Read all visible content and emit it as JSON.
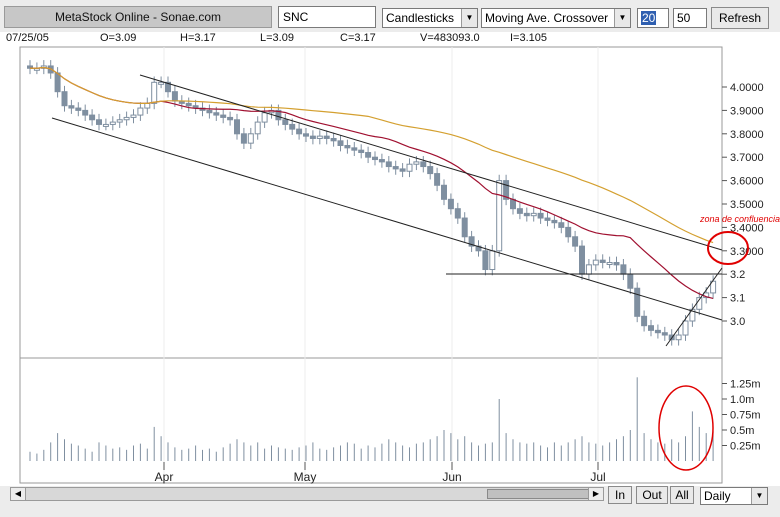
{
  "toolbar": {
    "title": "MetaStock Online - Sonae.com",
    "symbol": "SNC",
    "chart_type": "Candlesticks",
    "indicator": "Moving Ave. Crossover",
    "period1": "20",
    "period2": "50",
    "refresh_label": "Refresh"
  },
  "stats": {
    "date": "07/25/05",
    "open": "O=3.09",
    "high": "H=3.17",
    "low": "L=3.09",
    "close": "C=3.17",
    "volume": "V=483093.0",
    "i": "I=3.105"
  },
  "annotation": "zona de confluencia",
  "bottom": {
    "zoom_in": "In",
    "zoom_out": "Out",
    "all": "All",
    "period_select": "Daily"
  },
  "colors": {
    "candle": "#7f8fa0",
    "ma_short": "#a01030",
    "ma_long": "#d4a030",
    "annotation": "#e00000"
  },
  "chart_data": {
    "type": "candlestick",
    "x_tick_labels": [
      "Apr",
      "May",
      "Jun",
      "Jul"
    ],
    "price_ticks": [
      "4.0000",
      "3.9000",
      "3.8000",
      "3.7000",
      "3.6000",
      "3.5000",
      "3.4000",
      "3.3000",
      "3.2",
      "3.1",
      "3.0"
    ],
    "volume_ticks": [
      "1.25m",
      "1.0m",
      "0.75m",
      "0.5m",
      "0.25m"
    ],
    "horizontal_line_price": 3.2,
    "closes_approx": [
      4.08,
      4.08,
      4.09,
      4.06,
      3.98,
      3.92,
      3.91,
      3.9,
      3.88,
      3.86,
      3.84,
      3.84,
      3.85,
      3.86,
      3.87,
      3.88,
      3.91,
      3.93,
      4.02,
      4.02,
      3.98,
      3.94,
      3.93,
      3.92,
      3.91,
      3.9,
      3.89,
      3.88,
      3.87,
      3.86,
      3.8,
      3.76,
      3.8,
      3.85,
      3.89,
      3.9,
      3.86,
      3.84,
      3.82,
      3.8,
      3.79,
      3.78,
      3.79,
      3.78,
      3.77,
      3.75,
      3.74,
      3.73,
      3.72,
      3.7,
      3.69,
      3.68,
      3.66,
      3.65,
      3.64,
      3.67,
      3.68,
      3.66,
      3.63,
      3.58,
      3.52,
      3.48,
      3.44,
      3.36,
      3.32,
      3.3,
      3.22,
      3.3,
      3.6,
      3.52,
      3.48,
      3.46,
      3.45,
      3.46,
      3.44,
      3.43,
      3.42,
      3.4,
      3.36,
      3.32,
      3.2,
      3.24,
      3.26,
      3.25,
      3.25,
      3.24,
      3.2,
      3.14,
      3.02,
      2.98,
      2.96,
      2.95,
      2.94,
      2.92,
      2.94,
      3.0,
      3.05,
      3.1,
      3.12,
      3.17
    ],
    "volumes_approx": [
      0.15,
      0.12,
      0.18,
      0.3,
      0.45,
      0.35,
      0.28,
      0.25,
      0.2,
      0.15,
      0.3,
      0.25,
      0.2,
      0.22,
      0.18,
      0.25,
      0.28,
      0.2,
      0.55,
      0.4,
      0.3,
      0.22,
      0.18,
      0.2,
      0.25,
      0.18,
      0.2,
      0.15,
      0.22,
      0.28,
      0.35,
      0.3,
      0.25,
      0.3,
      0.2,
      0.25,
      0.22,
      0.2,
      0.18,
      0.22,
      0.25,
      0.3,
      0.2,
      0.18,
      0.22,
      0.25,
      0.3,
      0.28,
      0.2,
      0.25,
      0.22,
      0.28,
      0.35,
      0.3,
      0.25,
      0.22,
      0.28,
      0.3,
      0.35,
      0.4,
      0.5,
      0.45,
      0.35,
      0.4,
      0.3,
      0.25,
      0.28,
      0.3,
      1.0,
      0.45,
      0.35,
      0.3,
      0.28,
      0.3,
      0.25,
      0.22,
      0.3,
      0.25,
      0.3,
      0.35,
      0.4,
      0.3,
      0.28,
      0.25,
      0.3,
      0.35,
      0.4,
      0.5,
      1.35,
      0.45,
      0.35,
      0.3,
      0.28,
      0.35,
      0.3,
      0.4,
      0.8,
      0.55,
      0.45,
      0.48
    ]
  }
}
